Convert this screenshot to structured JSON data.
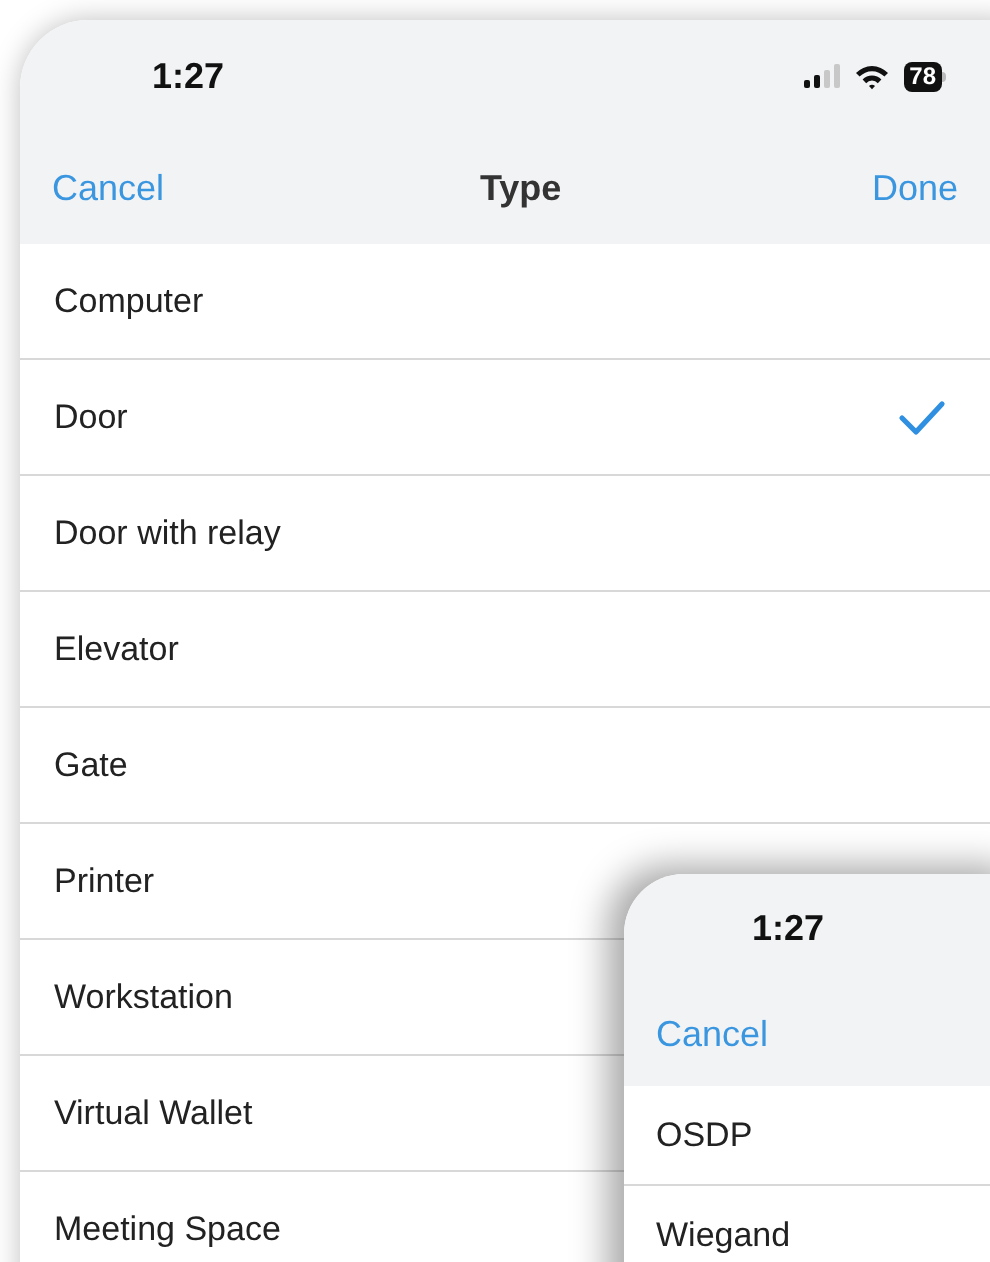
{
  "main_screen": {
    "status_bar": {
      "time": "1:27",
      "battery": "78"
    },
    "nav": {
      "cancel": "Cancel",
      "title": "Type",
      "done": "Done"
    },
    "items": [
      {
        "label": "Computer",
        "selected": false
      },
      {
        "label": "Door",
        "selected": true
      },
      {
        "label": "Door with relay",
        "selected": false
      },
      {
        "label": "Elevator",
        "selected": false
      },
      {
        "label": "Gate",
        "selected": false
      },
      {
        "label": "Printer",
        "selected": false
      },
      {
        "label": "Workstation"
      },
      {
        "label": "Virtual Wallet"
      },
      {
        "label": "Meeting Space"
      }
    ]
  },
  "second_screen": {
    "status_bar": {
      "time": "1:27"
    },
    "nav": {
      "cancel": "Cancel"
    },
    "items": [
      {
        "label": "OSDP"
      },
      {
        "label": "Wiegand"
      }
    ]
  }
}
